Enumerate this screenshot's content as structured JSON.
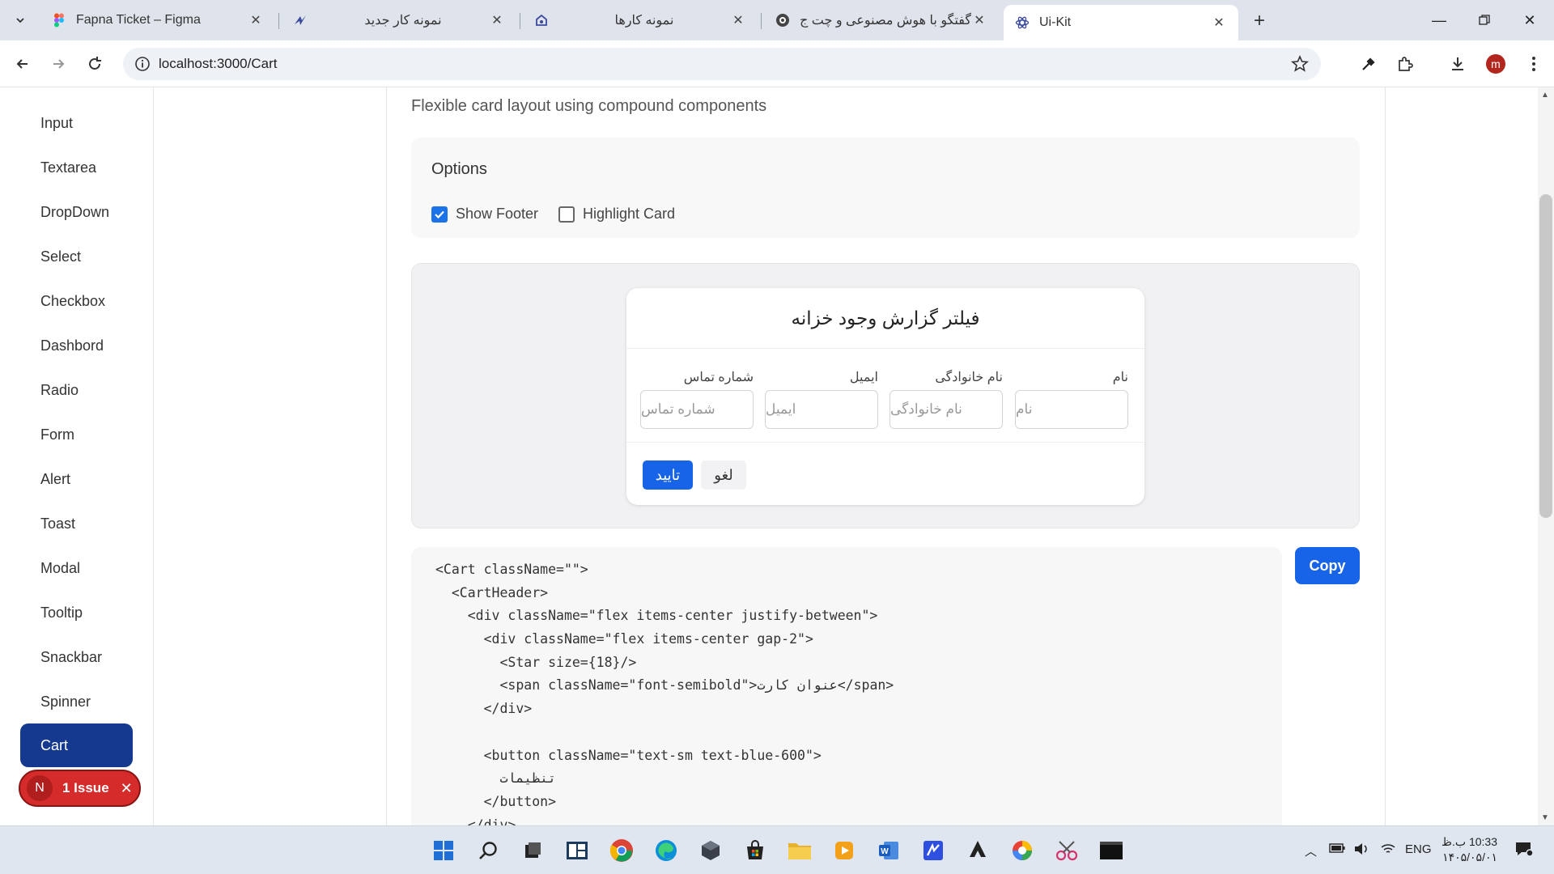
{
  "browser": {
    "tabs": [
      {
        "title": "Fapna Ticket – Figma",
        "favicon": "figma-icon"
      },
      {
        "title": "نمونه کار جدید",
        "favicon": "app-icon"
      },
      {
        "title": "نمونه کارها",
        "favicon": "home-icon"
      },
      {
        "title": "گفتگو با هوش مصنوعی و چت ج",
        "favicon": "chat-icon"
      },
      {
        "title": "Ui-Kit",
        "favicon": "react-icon",
        "active": true
      }
    ],
    "url": "localhost:3000/Cart",
    "profile_initial": "m"
  },
  "sidebar": {
    "items": [
      "Input",
      "Textarea",
      "DropDown",
      "Select",
      "Checkbox",
      "Dashbord",
      "Radio",
      "Form",
      "Alert",
      "Toast",
      "Modal",
      "Tooltip",
      "Snackbar",
      "Spinner"
    ],
    "active": "Cart"
  },
  "issue_badge": {
    "initial": "N",
    "label": "1 Issue"
  },
  "main": {
    "subtitle": "Flexible card layout using compound components",
    "options": {
      "title": "Options",
      "show_footer": {
        "label": "Show Footer",
        "checked": true
      },
      "highlight_card": {
        "label": "Highlight Card",
        "checked": false
      }
    },
    "card": {
      "title": "فیلتر گزارش وجود خزانه",
      "fields": [
        {
          "label": "نام",
          "placeholder": "نام"
        },
        {
          "label": "نام خانوادگی",
          "placeholder": "نام خانوادگی"
        },
        {
          "label": "ایمیل",
          "placeholder": "ایمیل"
        },
        {
          "label": "شماره تماس",
          "placeholder": "شماره تماس"
        }
      ],
      "confirm_label": "تایید",
      "cancel_label": "لغو"
    },
    "code_lines": [
      "<Cart className=\"\">",
      "  <CartHeader>",
      "    <div className=\"flex items-center justify-between\">",
      "      <div className=\"flex items-center gap-2\">",
      "        <Star size={18}/>",
      "        <span className=\"font-semibold\">عنوان کارت</span>",
      "      </div>",
      "",
      "      <button className=\"text-sm text-blue-600\">",
      "        تنظیمات",
      "      </button>",
      "    </div>"
    ],
    "copy_label": "Copy"
  },
  "taskbar": {
    "lang": "ENG",
    "time": "10:33 ب.ظ",
    "date": "۱۴۰۵/۰۵/۰۱"
  },
  "colors": {
    "accent": "#1864e8",
    "sidebar_active": "#15398f",
    "issue": "#d52b2b"
  }
}
